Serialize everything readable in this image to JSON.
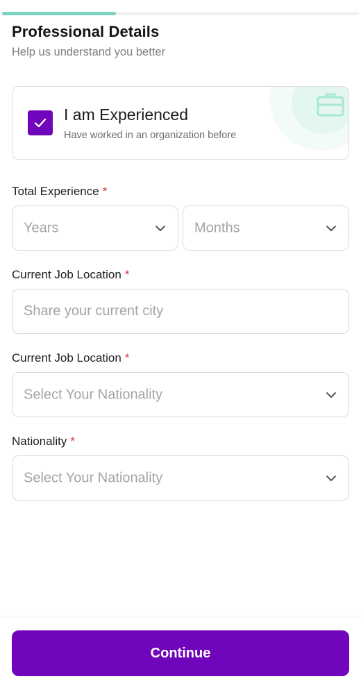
{
  "progress": {
    "fraction": 0.32,
    "color": "#79d3c0"
  },
  "header": {
    "title": "Professional Details",
    "subtitle": "Help us understand you better"
  },
  "experience_card": {
    "checked": true,
    "title": "I am Experienced",
    "description": "Have worked in an organization before",
    "icon": "briefcase-icon"
  },
  "total_experience": {
    "label": "Total Experience",
    "required_mark": "*",
    "years": {
      "value": "Years",
      "icon": "chevron-down-icon"
    },
    "months": {
      "value": "Months",
      "icon": "chevron-down-icon"
    }
  },
  "current_city": {
    "label": "Current Job Location",
    "required_mark": "*",
    "placeholder": "Share your current city"
  },
  "current_job_location": {
    "label": "Current Job Location",
    "required_mark": "*",
    "value": "Select Your Nationality",
    "icon": "chevron-down-icon"
  },
  "nationality": {
    "label": "Nationality",
    "required_mark": "*",
    "value": "Select Your Nationality",
    "icon": "chevron-down-icon"
  },
  "footer": {
    "continue_label": "Continue"
  },
  "colors": {
    "brand": "#6f06bb",
    "accent": "#79d3c0",
    "required": "#e0323c"
  }
}
